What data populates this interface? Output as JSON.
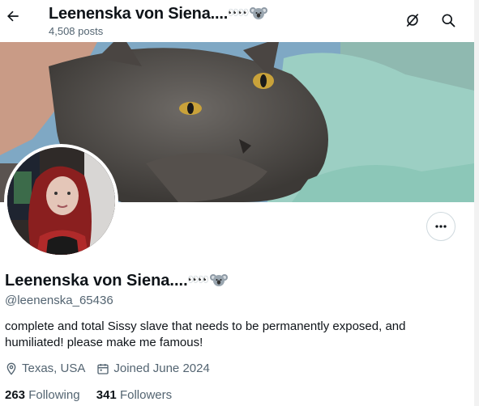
{
  "header": {
    "name": "Leenenska von Siena....",
    "name_emoji": "👀👀",
    "posts": "4,508 posts",
    "back_icon": "arrow-left-icon",
    "grok_icon": "grok-icon",
    "search_icon": "search-icon"
  },
  "profile": {
    "name": "Leenenska von Siena....",
    "name_emoji": "👀👀",
    "handle": "@leenenska_65436",
    "bio": "complete and total Sissy slave that needs to be permanently exposed, and humiliated! please make me famous!",
    "location": "Texas, USA",
    "joined": "Joined June 2024",
    "following_count": "263",
    "following_label": "Following",
    "followers_count": "341",
    "followers_label": "Followers"
  },
  "colors": {
    "text": "#0f1419",
    "secondary": "#536471",
    "border": "#cfd9de"
  }
}
